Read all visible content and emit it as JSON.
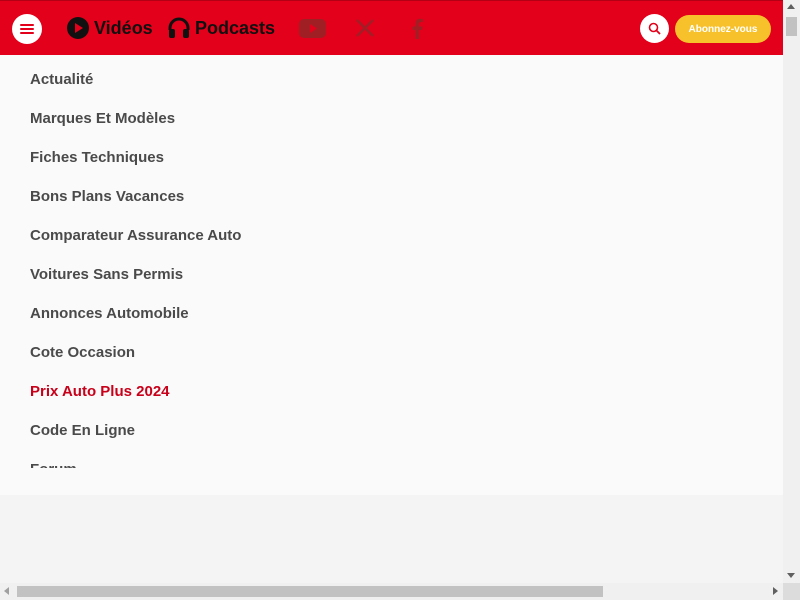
{
  "header": {
    "menu_icon": "hamburger-menu-icon",
    "nav": [
      {
        "label": "Vidéos",
        "icon": "play-circle-icon"
      },
      {
        "label": "Podcasts",
        "icon": "headphones-icon"
      }
    ],
    "social": [
      {
        "name": "youtube",
        "icon": "youtube-icon"
      },
      {
        "name": "x",
        "icon": "x-twitter-icon"
      },
      {
        "name": "facebook",
        "icon": "facebook-icon"
      }
    ],
    "search_icon": "search-icon",
    "subscribe_label": "Abonnez-vous"
  },
  "menu": {
    "items": [
      {
        "label": "Actualité"
      },
      {
        "label": "Marques Et Modèles"
      },
      {
        "label": "Fiches Techniques"
      },
      {
        "label": "Bons Plans Vacances"
      },
      {
        "label": "Comparateur Assurance Auto"
      },
      {
        "label": "Voitures Sans Permis"
      },
      {
        "label": "Annonces Automobile"
      },
      {
        "label": "Cote Occasion"
      },
      {
        "label": "Prix Auto Plus 2024",
        "highlight": true
      },
      {
        "label": "Code En Ligne"
      },
      {
        "label": "Forum"
      }
    ]
  },
  "colors": {
    "header_bg": "#e2001a",
    "subscribe_bg": "#f7c12c",
    "highlight_text": "#c8001a",
    "menu_text": "#4a4a4a"
  }
}
